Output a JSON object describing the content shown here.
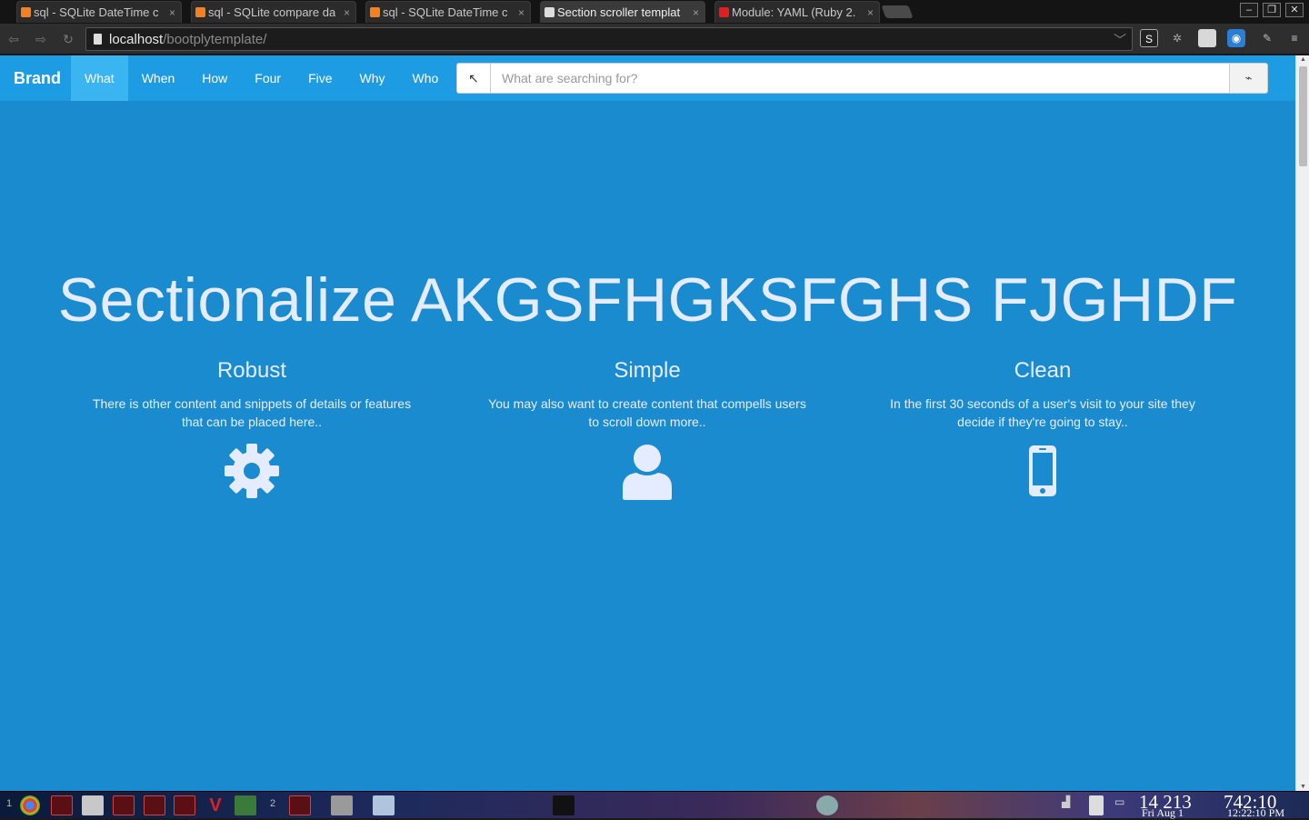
{
  "browser": {
    "tabs": [
      {
        "label": "sql - SQLite DateTime c",
        "favicon_color": "#f48024",
        "active": false
      },
      {
        "label": "sql - SQLite compare da",
        "favicon_color": "#f48024",
        "active": false
      },
      {
        "label": "sql - SQLite DateTime c",
        "favicon_color": "#f48024",
        "active": false
      },
      {
        "label": "Section scroller templat",
        "favicon_color": "#dddddd",
        "active": true
      },
      {
        "label": "Module: YAML (Ruby 2.",
        "favicon_color": "#e02020",
        "active": false
      }
    ],
    "tab_close_glyph": "×",
    "window_controls": {
      "minimize": "–",
      "restore": "❐",
      "close": "✕"
    },
    "address": {
      "host": "localhost",
      "path": "/bootplytemplate/"
    },
    "nav_glyphs": {
      "back": "⇦",
      "forward": "⇨",
      "reload": "↻"
    }
  },
  "site": {
    "brand": "Brand",
    "nav": [
      {
        "label": "What",
        "active": true
      },
      {
        "label": "When",
        "active": false
      },
      {
        "label": "How",
        "active": false
      },
      {
        "label": "Four",
        "active": false
      },
      {
        "label": "Five",
        "active": false
      },
      {
        "label": "Why",
        "active": false
      },
      {
        "label": "Who",
        "active": false
      }
    ],
    "search": {
      "prefix_glyph": "↖",
      "placeholder": "What are searching for?",
      "button_glyph": "⌁"
    },
    "hero_title": "Sectionalize AKGSFHGKSFGHS FJGHDF",
    "features": [
      {
        "title": "Robust",
        "text": "There is other content and snippets of details or features that can be placed here..",
        "icon": "gear-icon"
      },
      {
        "title": "Simple",
        "text": "You may also want to create content that compells users to scroll down more..",
        "icon": "user-icon"
      },
      {
        "title": "Clean",
        "text": "In the first 30 seconds of a user's visit to your site they decide if they're going to stay..",
        "icon": "mobile-icon"
      }
    ]
  },
  "taskbar": {
    "workspace_1": "1",
    "workspace_2": "2",
    "counter": "14 213",
    "date": "Fri Aug 1",
    "uptime": "742:10",
    "clock": "12:22:10 PM"
  },
  "colors": {
    "page_bg": "#1a8bce",
    "navbar_bg": "#1d9be3",
    "active_nav": "#3bb4f2",
    "hero_text": "#e6ecff"
  }
}
